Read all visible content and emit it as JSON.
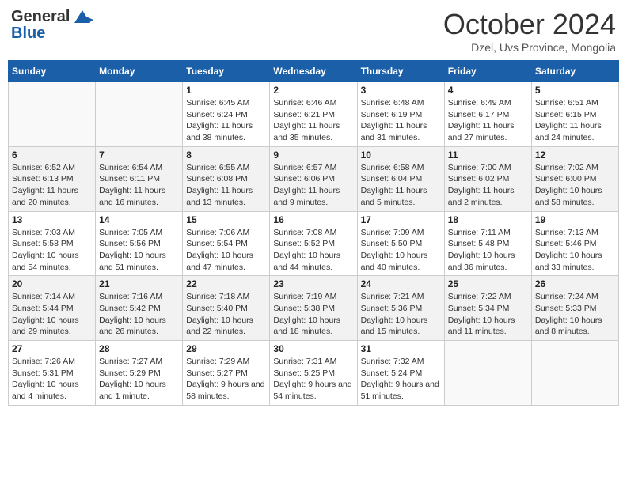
{
  "header": {
    "logo_line1": "General",
    "logo_line2": "Blue",
    "month_title": "October 2024",
    "subtitle": "Dzel, Uvs Province, Mongolia"
  },
  "weekdays": [
    "Sunday",
    "Monday",
    "Tuesday",
    "Wednesday",
    "Thursday",
    "Friday",
    "Saturday"
  ],
  "weeks": [
    [
      {
        "day": "",
        "sunrise": "",
        "sunset": "",
        "daylight": "",
        "empty": true
      },
      {
        "day": "",
        "sunrise": "",
        "sunset": "",
        "daylight": "",
        "empty": true
      },
      {
        "day": "1",
        "sunrise": "Sunrise: 6:45 AM",
        "sunset": "Sunset: 6:24 PM",
        "daylight": "Daylight: 11 hours and 38 minutes.",
        "empty": false
      },
      {
        "day": "2",
        "sunrise": "Sunrise: 6:46 AM",
        "sunset": "Sunset: 6:21 PM",
        "daylight": "Daylight: 11 hours and 35 minutes.",
        "empty": false
      },
      {
        "day": "3",
        "sunrise": "Sunrise: 6:48 AM",
        "sunset": "Sunset: 6:19 PM",
        "daylight": "Daylight: 11 hours and 31 minutes.",
        "empty": false
      },
      {
        "day": "4",
        "sunrise": "Sunrise: 6:49 AM",
        "sunset": "Sunset: 6:17 PM",
        "daylight": "Daylight: 11 hours and 27 minutes.",
        "empty": false
      },
      {
        "day": "5",
        "sunrise": "Sunrise: 6:51 AM",
        "sunset": "Sunset: 6:15 PM",
        "daylight": "Daylight: 11 hours and 24 minutes.",
        "empty": false
      }
    ],
    [
      {
        "day": "6",
        "sunrise": "Sunrise: 6:52 AM",
        "sunset": "Sunset: 6:13 PM",
        "daylight": "Daylight: 11 hours and 20 minutes.",
        "empty": false
      },
      {
        "day": "7",
        "sunrise": "Sunrise: 6:54 AM",
        "sunset": "Sunset: 6:11 PM",
        "daylight": "Daylight: 11 hours and 16 minutes.",
        "empty": false
      },
      {
        "day": "8",
        "sunrise": "Sunrise: 6:55 AM",
        "sunset": "Sunset: 6:08 PM",
        "daylight": "Daylight: 11 hours and 13 minutes.",
        "empty": false
      },
      {
        "day": "9",
        "sunrise": "Sunrise: 6:57 AM",
        "sunset": "Sunset: 6:06 PM",
        "daylight": "Daylight: 11 hours and 9 minutes.",
        "empty": false
      },
      {
        "day": "10",
        "sunrise": "Sunrise: 6:58 AM",
        "sunset": "Sunset: 6:04 PM",
        "daylight": "Daylight: 11 hours and 5 minutes.",
        "empty": false
      },
      {
        "day": "11",
        "sunrise": "Sunrise: 7:00 AM",
        "sunset": "Sunset: 6:02 PM",
        "daylight": "Daylight: 11 hours and 2 minutes.",
        "empty": false
      },
      {
        "day": "12",
        "sunrise": "Sunrise: 7:02 AM",
        "sunset": "Sunset: 6:00 PM",
        "daylight": "Daylight: 10 hours and 58 minutes.",
        "empty": false
      }
    ],
    [
      {
        "day": "13",
        "sunrise": "Sunrise: 7:03 AM",
        "sunset": "Sunset: 5:58 PM",
        "daylight": "Daylight: 10 hours and 54 minutes.",
        "empty": false
      },
      {
        "day": "14",
        "sunrise": "Sunrise: 7:05 AM",
        "sunset": "Sunset: 5:56 PM",
        "daylight": "Daylight: 10 hours and 51 minutes.",
        "empty": false
      },
      {
        "day": "15",
        "sunrise": "Sunrise: 7:06 AM",
        "sunset": "Sunset: 5:54 PM",
        "daylight": "Daylight: 10 hours and 47 minutes.",
        "empty": false
      },
      {
        "day": "16",
        "sunrise": "Sunrise: 7:08 AM",
        "sunset": "Sunset: 5:52 PM",
        "daylight": "Daylight: 10 hours and 44 minutes.",
        "empty": false
      },
      {
        "day": "17",
        "sunrise": "Sunrise: 7:09 AM",
        "sunset": "Sunset: 5:50 PM",
        "daylight": "Daylight: 10 hours and 40 minutes.",
        "empty": false
      },
      {
        "day": "18",
        "sunrise": "Sunrise: 7:11 AM",
        "sunset": "Sunset: 5:48 PM",
        "daylight": "Daylight: 10 hours and 36 minutes.",
        "empty": false
      },
      {
        "day": "19",
        "sunrise": "Sunrise: 7:13 AM",
        "sunset": "Sunset: 5:46 PM",
        "daylight": "Daylight: 10 hours and 33 minutes.",
        "empty": false
      }
    ],
    [
      {
        "day": "20",
        "sunrise": "Sunrise: 7:14 AM",
        "sunset": "Sunset: 5:44 PM",
        "daylight": "Daylight: 10 hours and 29 minutes.",
        "empty": false
      },
      {
        "day": "21",
        "sunrise": "Sunrise: 7:16 AM",
        "sunset": "Sunset: 5:42 PM",
        "daylight": "Daylight: 10 hours and 26 minutes.",
        "empty": false
      },
      {
        "day": "22",
        "sunrise": "Sunrise: 7:18 AM",
        "sunset": "Sunset: 5:40 PM",
        "daylight": "Daylight: 10 hours and 22 minutes.",
        "empty": false
      },
      {
        "day": "23",
        "sunrise": "Sunrise: 7:19 AM",
        "sunset": "Sunset: 5:38 PM",
        "daylight": "Daylight: 10 hours and 18 minutes.",
        "empty": false
      },
      {
        "day": "24",
        "sunrise": "Sunrise: 7:21 AM",
        "sunset": "Sunset: 5:36 PM",
        "daylight": "Daylight: 10 hours and 15 minutes.",
        "empty": false
      },
      {
        "day": "25",
        "sunrise": "Sunrise: 7:22 AM",
        "sunset": "Sunset: 5:34 PM",
        "daylight": "Daylight: 10 hours and 11 minutes.",
        "empty": false
      },
      {
        "day": "26",
        "sunrise": "Sunrise: 7:24 AM",
        "sunset": "Sunset: 5:33 PM",
        "daylight": "Daylight: 10 hours and 8 minutes.",
        "empty": false
      }
    ],
    [
      {
        "day": "27",
        "sunrise": "Sunrise: 7:26 AM",
        "sunset": "Sunset: 5:31 PM",
        "daylight": "Daylight: 10 hours and 4 minutes.",
        "empty": false
      },
      {
        "day": "28",
        "sunrise": "Sunrise: 7:27 AM",
        "sunset": "Sunset: 5:29 PM",
        "daylight": "Daylight: 10 hours and 1 minute.",
        "empty": false
      },
      {
        "day": "29",
        "sunrise": "Sunrise: 7:29 AM",
        "sunset": "Sunset: 5:27 PM",
        "daylight": "Daylight: 9 hours and 58 minutes.",
        "empty": false
      },
      {
        "day": "30",
        "sunrise": "Sunrise: 7:31 AM",
        "sunset": "Sunset: 5:25 PM",
        "daylight": "Daylight: 9 hours and 54 minutes.",
        "empty": false
      },
      {
        "day": "31",
        "sunrise": "Sunrise: 7:32 AM",
        "sunset": "Sunset: 5:24 PM",
        "daylight": "Daylight: 9 hours and 51 minutes.",
        "empty": false
      },
      {
        "day": "",
        "sunrise": "",
        "sunset": "",
        "daylight": "",
        "empty": true
      },
      {
        "day": "",
        "sunrise": "",
        "sunset": "",
        "daylight": "",
        "empty": true
      }
    ]
  ]
}
